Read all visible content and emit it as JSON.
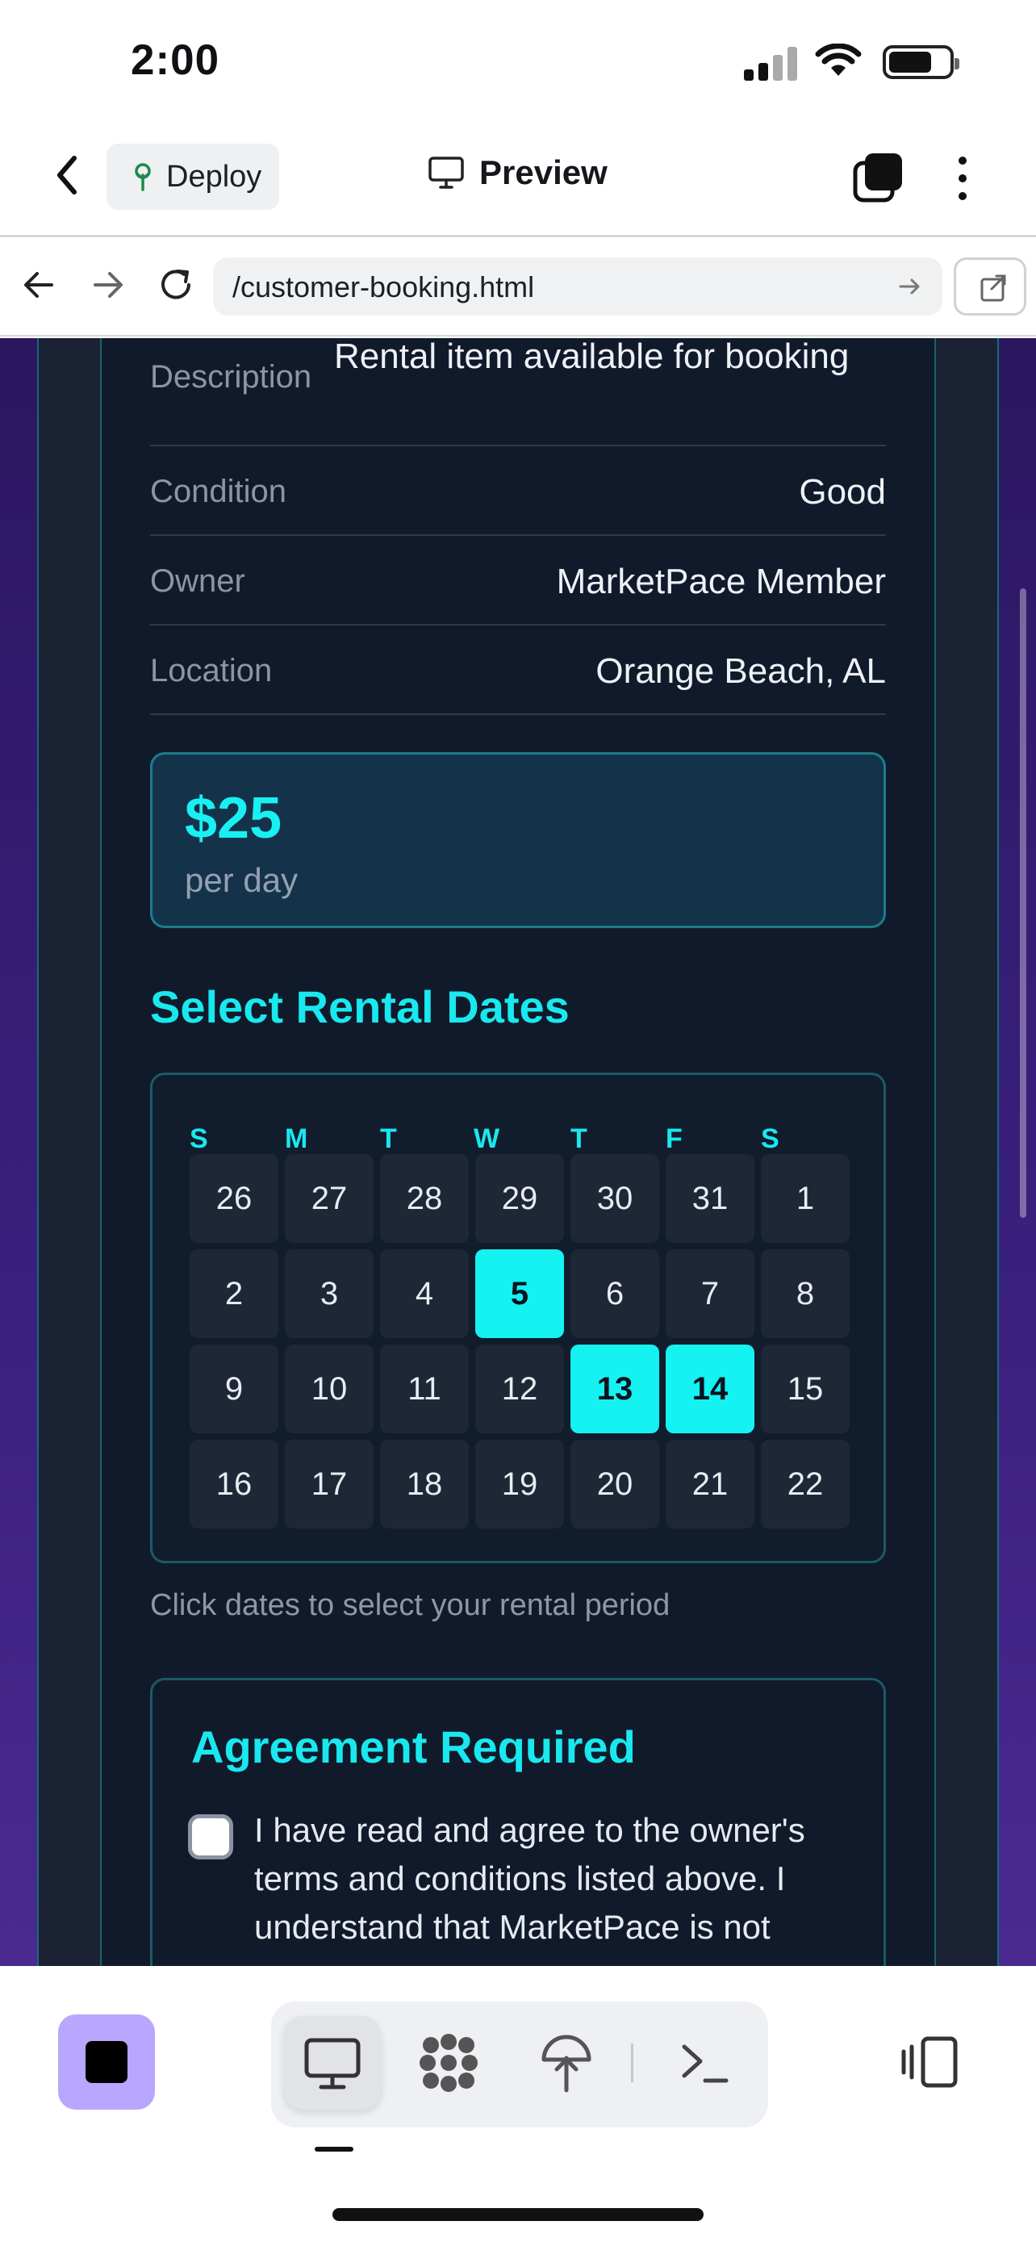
{
  "status_bar": {
    "time": "2:00"
  },
  "navbar": {
    "deploy_label": "Deploy",
    "preview_label": "Preview"
  },
  "url_bar": {
    "url": "/customer-booking.html"
  },
  "details": {
    "description": {
      "label": "Description",
      "value": "Rental item available for booking"
    },
    "condition": {
      "label": "Condition",
      "value": "Good"
    },
    "owner": {
      "label": "Owner",
      "value": "MarketPace Member"
    },
    "location": {
      "label": "Location",
      "value": "Orange Beach, AL"
    }
  },
  "price": {
    "amount": "$25",
    "unit": "per day"
  },
  "calendar": {
    "title": "Select Rental Dates",
    "weekdays": [
      "S",
      "M",
      "T",
      "W",
      "T",
      "F",
      "S"
    ],
    "weeks": [
      [
        "26",
        "27",
        "28",
        "29",
        "30",
        "31",
        "1"
      ],
      [
        "2",
        "3",
        "4",
        "5",
        "6",
        "7",
        "8"
      ],
      [
        "9",
        "10",
        "11",
        "12",
        "13",
        "14",
        "15"
      ],
      [
        "16",
        "17",
        "18",
        "19",
        "20",
        "21",
        "22"
      ]
    ],
    "selected": [
      "5",
      "13",
      "14"
    ],
    "hint": "Click dates to select your rental period"
  },
  "agreement": {
    "title": "Agreement Required",
    "checked": false,
    "text": "I have read and agree to the owner's terms and conditions listed above. I understand that MarketPace is not"
  },
  "colors": {
    "accent": "#19e8ef",
    "selected_day": "#14f2f2",
    "card_bg": "#111a2b",
    "stop_button": "#b9a6ff"
  },
  "icons": {
    "deploy": "sprout-icon",
    "preview": "monitor-icon",
    "dock": [
      "monitor-icon",
      "apps-icon",
      "deploy-icon",
      "terminal-icon"
    ]
  }
}
